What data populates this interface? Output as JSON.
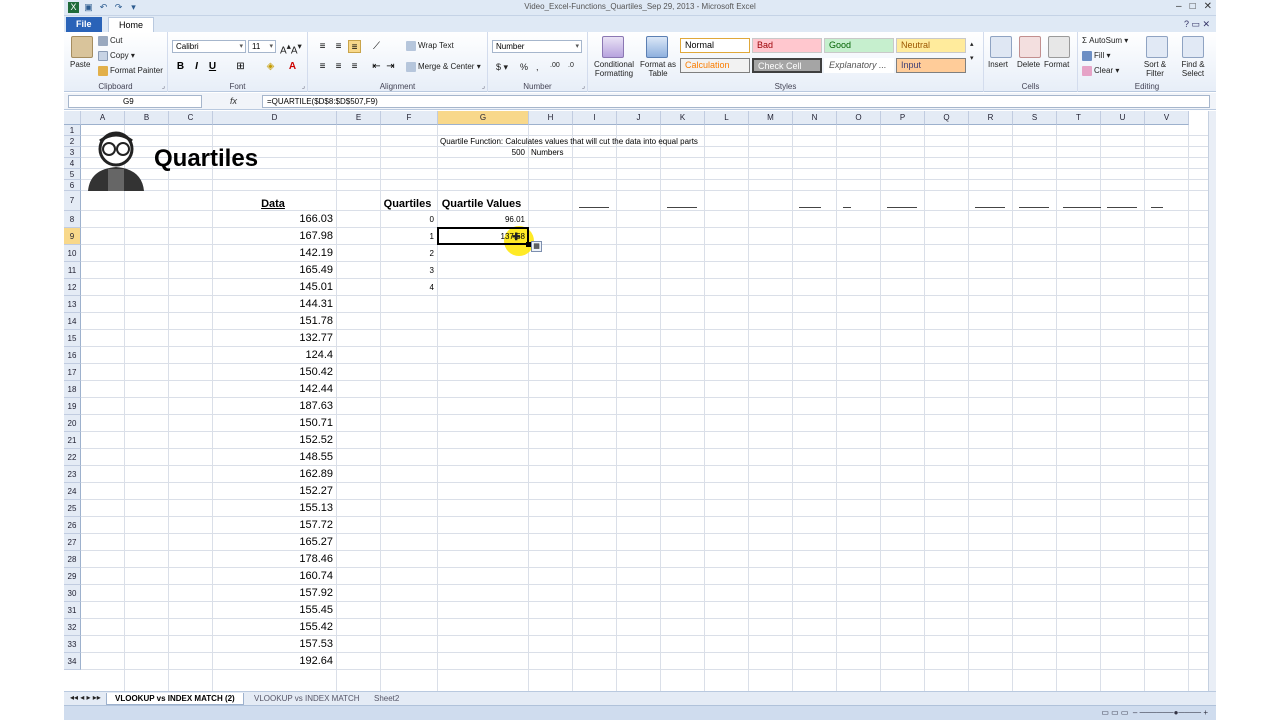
{
  "window": {
    "title": "Video_Excel-Functions_Quartiles_Sep 29, 2013 - Microsoft Excel"
  },
  "ribbon_tabs": {
    "file": "File",
    "home": "Home"
  },
  "ribbon": {
    "clipboard": {
      "label": "Clipboard",
      "paste": "Paste",
      "cut": "Cut",
      "copy": "Copy",
      "format_painter": "Format Painter"
    },
    "font": {
      "label": "Font",
      "font_name": "Calibri",
      "font_size": "11"
    },
    "alignment": {
      "label": "Alignment",
      "wrap_text": "Wrap Text",
      "merge_center": "Merge & Center"
    },
    "number": {
      "label": "Number",
      "format": "Number"
    },
    "styles": {
      "label": "Styles",
      "conditional": "Conditional Formatting",
      "format_table": "Format as Table",
      "items": [
        "Normal",
        "Bad",
        "Good",
        "Neutral",
        "Calculation",
        "Check Cell",
        "Explanatory ...",
        "Input"
      ]
    },
    "cells": {
      "label": "Cells",
      "insert": "Insert",
      "delete": "Delete",
      "format": "Format"
    },
    "editing": {
      "label": "Editing",
      "autosum": "AutoSum",
      "fill": "Fill",
      "clear": "Clear",
      "sort_filter": "Sort & Filter",
      "find_select": "Find & Select"
    }
  },
  "formula_bar": {
    "name_box": "G9",
    "fx": "fx",
    "formula": "=QUARTILE($D$8:$D$507,F9)"
  },
  "columns": [
    "A",
    "B",
    "C",
    "D",
    "E",
    "F",
    "G",
    "H",
    "I",
    "J",
    "K",
    "L",
    "M",
    "N",
    "O",
    "P",
    "Q",
    "R",
    "S",
    "T",
    "U",
    "V"
  ],
  "rows": [
    "1",
    "2",
    "3",
    "4",
    "5",
    "6",
    "7",
    "8",
    "9",
    "10",
    "11",
    "12",
    "13",
    "14",
    "15",
    "16",
    "17",
    "18",
    "19",
    "20",
    "21",
    "22",
    "23",
    "24",
    "25",
    "26",
    "27",
    "28",
    "29",
    "30",
    "31",
    "32",
    "33",
    "34"
  ],
  "sheet": {
    "title": "Quartiles",
    "description": "Quartile Function: Calculates values that will cut the data into equal parts",
    "count": "500",
    "count_label": "Numbers",
    "data_header": "Data",
    "quartiles_header": "Quartiles",
    "values_header": "Quartile Values",
    "data": [
      "166.03",
      "167.98",
      "142.19",
      "165.49",
      "145.01",
      "144.31",
      "151.78",
      "132.77",
      "124.4",
      "150.42",
      "142.44",
      "187.63",
      "150.71",
      "152.52",
      "148.55",
      "162.89",
      "152.27",
      "155.13",
      "157.72",
      "165.27",
      "178.46",
      "160.74",
      "157.92",
      "155.45",
      "155.42",
      "157.53",
      "192.64"
    ],
    "quartiles": [
      "0",
      "1",
      "2",
      "3",
      "4"
    ],
    "values": [
      "96.01",
      "137.58"
    ]
  },
  "sheet_tabs": [
    "VLOOKUP vs INDEX MATCH (2)",
    "VLOOKUP vs INDEX MATCH",
    "Sheet2"
  ],
  "colors": {
    "accent": "#2a63b8",
    "selected_header": "#f8d88a",
    "highlight": "#ffe600"
  }
}
